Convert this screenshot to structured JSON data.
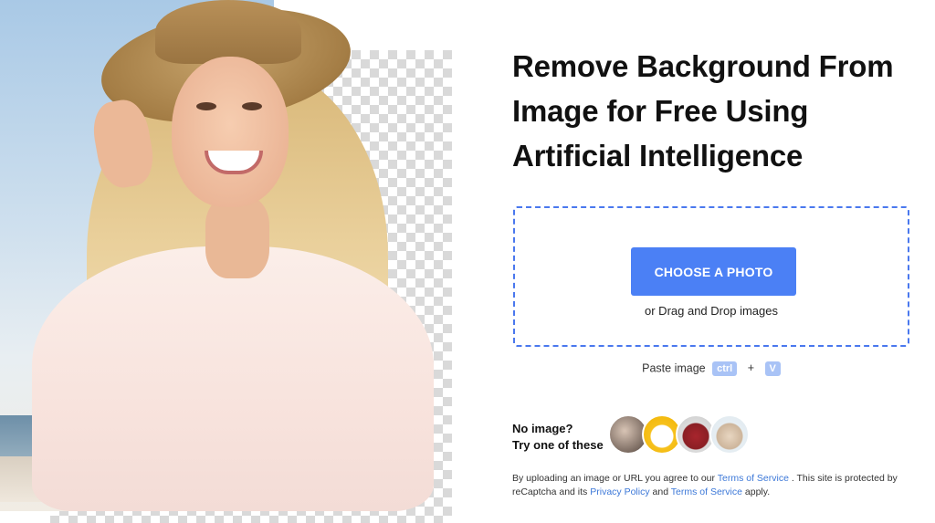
{
  "hero": {
    "headline": "Remove Background From Image for Free Using Artificial Intelligence"
  },
  "upload": {
    "button_label": "CHOOSE A PHOTO",
    "drag_drop_text": "or Drag and Drop images"
  },
  "paste": {
    "label": "Paste image",
    "key_ctrl": "ctrl",
    "plus": "+",
    "key_v": "V"
  },
  "samples": {
    "prompt_line1": "No image?",
    "prompt_line2": "Try one of these",
    "items": [
      "sample-people",
      "sample-car",
      "sample-backpack",
      "sample-dog"
    ]
  },
  "legal": {
    "text_1": "By uploading an image or URL you agree to our",
    "terms_link": "Terms of Service",
    "text_2": ". This site is protected by reCaptcha and its",
    "privacy_link": "Privacy Policy",
    "text_3": "and",
    "terms_link_2": "Terms of Service",
    "text_4": "apply."
  },
  "colors": {
    "accent": "#4b80f5",
    "dropzone_border": "#4a78ee",
    "link": "#3c78d8",
    "kbd_bg": "#a9c3f6"
  }
}
